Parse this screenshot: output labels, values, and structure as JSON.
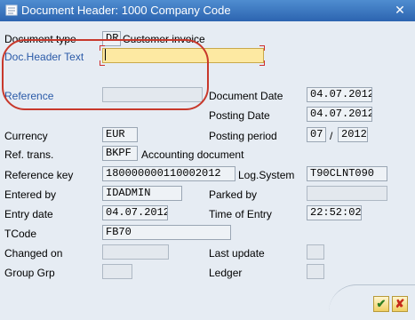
{
  "window": {
    "title": "Document Header: 1000 Company Code",
    "close_glyph": "✕"
  },
  "fields": {
    "document_type": {
      "label": "Document type",
      "value": "DR",
      "description": "Customer invoice"
    },
    "doc_header_text": {
      "label": "Doc.Header Text",
      "value": ""
    },
    "reference": {
      "label": "Reference",
      "value": ""
    },
    "document_date": {
      "label": "Document Date",
      "value": "04.07.2012"
    },
    "posting_date": {
      "label": "Posting Date",
      "value": "04.07.2012"
    },
    "currency": {
      "label": "Currency",
      "value": "EUR"
    },
    "posting_period": {
      "label": "Posting period",
      "period": "07",
      "separator": "/",
      "year": "2012"
    },
    "ref_trans": {
      "label": "Ref. trans.",
      "value": "BKPF",
      "description": "Accounting document"
    },
    "reference_key": {
      "label": "Reference key",
      "value": "180000000110002012"
    },
    "log_system": {
      "label": "Log.System",
      "value": "T90CLNT090"
    },
    "entered_by": {
      "label": "Entered by",
      "value": "IDADMIN"
    },
    "parked_by": {
      "label": "Parked by",
      "value": ""
    },
    "entry_date": {
      "label": "Entry date",
      "value": "04.07.2012"
    },
    "time_of_entry": {
      "label": "Time of Entry",
      "value": "22:52:02"
    },
    "tcode": {
      "label": "TCode",
      "value": "FB70"
    },
    "changed_on": {
      "label": "Changed on",
      "value": ""
    },
    "last_update": {
      "label": "Last update",
      "value": ""
    },
    "group_grp": {
      "label": "Group Grp",
      "value": ""
    },
    "ledger": {
      "label": "Ledger",
      "value": ""
    }
  },
  "buttons": {
    "ok_glyph": "✔",
    "cancel_glyph": "✘"
  },
  "icons": [
    "document-icon",
    "close-icon",
    "checkmark-icon",
    "cancel-icon"
  ],
  "colors": {
    "titlebar": "#2c64b0",
    "highlight_oval": "#c8382b",
    "active_field": "#fde9a2",
    "link_label": "#2a5aa8"
  }
}
